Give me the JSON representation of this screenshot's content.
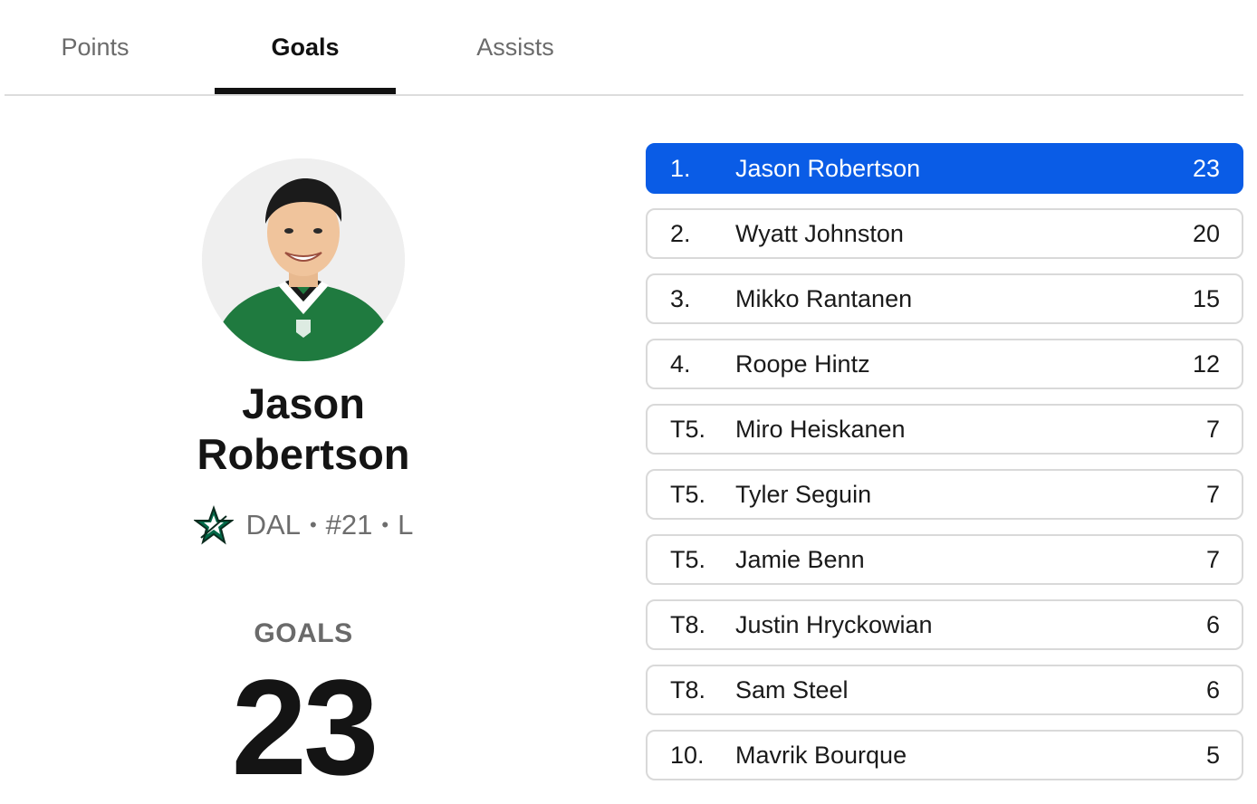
{
  "tabs": [
    {
      "label": "Points",
      "active": false
    },
    {
      "label": "Goals",
      "active": true
    },
    {
      "label": "Assists",
      "active": false
    }
  ],
  "player": {
    "first_name": "Jason",
    "last_name": "Robertson",
    "team": "DAL",
    "number": "#21",
    "position": "L",
    "separator": "•",
    "stat_label": "GOALS",
    "stat_value": "23",
    "jersey_color": "#1f7a3f"
  },
  "leaders": [
    {
      "rank": "1.",
      "name": "Jason Robertson",
      "value": "23",
      "selected": true
    },
    {
      "rank": "2.",
      "name": "Wyatt Johnston",
      "value": "20"
    },
    {
      "rank": "3.",
      "name": "Mikko Rantanen",
      "value": "15"
    },
    {
      "rank": "4.",
      "name": "Roope Hintz",
      "value": "12"
    },
    {
      "rank": "T5.",
      "name": "Miro Heiskanen",
      "value": "7"
    },
    {
      "rank": "T5.",
      "name": "Tyler Seguin",
      "value": "7"
    },
    {
      "rank": "T5.",
      "name": "Jamie Benn",
      "value": "7"
    },
    {
      "rank": "T8.",
      "name": "Justin Hryckowian",
      "value": "6"
    },
    {
      "rank": "T8.",
      "name": "Sam Steel",
      "value": "6"
    },
    {
      "rank": "10.",
      "name": "Mavrik Bourque",
      "value": "5"
    }
  ],
  "colors": {
    "accent": "#0a5ce6",
    "team_green": "#006847"
  }
}
